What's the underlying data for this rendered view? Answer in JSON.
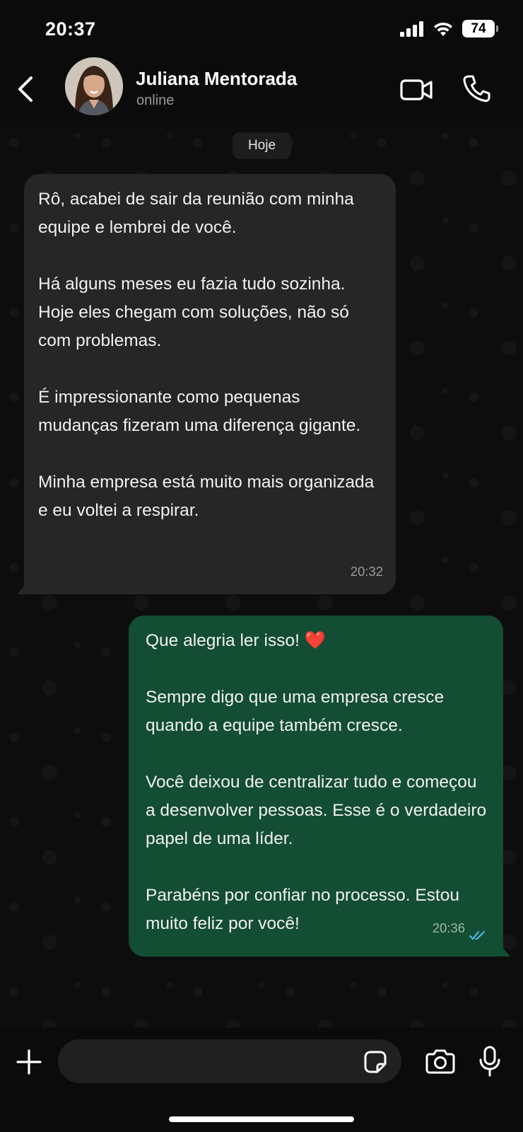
{
  "status_bar": {
    "time": "20:37",
    "battery": "74"
  },
  "header": {
    "contact_name": "Juliana Mentorada",
    "contact_status": "online",
    "icons": [
      "back-chevron-icon",
      "video-call-icon",
      "phone-icon"
    ]
  },
  "chat": {
    "date_chip": "Hoje",
    "messages": [
      {
        "direction": "incoming",
        "paragraphs": [
          "Rô, acabei de sair da reunião com minha equipe e lembrei de você.",
          "Há alguns meses eu fazia tudo sozinha. Hoje eles chegam com soluções, não só com problemas.",
          "É impressionante como pequenas mudanças fizeram uma diferença gigante.",
          "Minha empresa está muito mais organizada e eu voltei a respirar."
        ],
        "time": "20:32"
      },
      {
        "direction": "outgoing",
        "paragraphs": [
          "Que alegria ler isso! ❤️",
          "Sempre digo que uma empresa cresce quando a equipe também cresce.",
          "Você deixou de centralizar tudo e começou a desenvolver pessoas. Esse é o verdadeiro papel de uma líder.",
          "Parabéns por confiar no processo. Estou muito feliz por você!"
        ],
        "time": "20:36",
        "status": "read"
      }
    ]
  },
  "composer": {
    "placeholder": "",
    "icons": [
      "plus-icon",
      "sticker-icon",
      "camera-icon",
      "microphone-icon"
    ]
  },
  "colors": {
    "incoming_bubble": "#262626",
    "outgoing_bubble": "#134d34",
    "read_ticks": "#53bdeb",
    "background": "#0b0b0b"
  }
}
